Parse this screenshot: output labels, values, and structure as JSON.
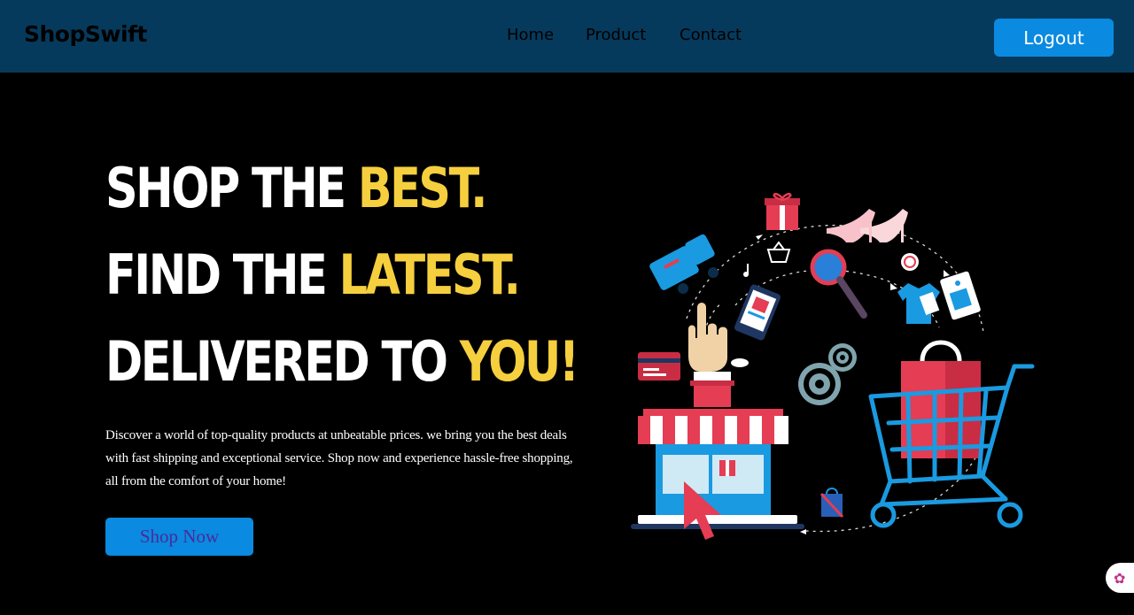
{
  "nav": {
    "brand": "ShopSwift",
    "links": [
      "Home",
      "Product",
      "Contact"
    ],
    "logout_label": "Logout"
  },
  "hero": {
    "line1": {
      "text": "SHOP THE ",
      "accent": "BEST."
    },
    "line2": {
      "text": "FIND THE ",
      "accent": "LATEST."
    },
    "line3": {
      "text": "DELIVERED TO ",
      "accent": "YOU!"
    },
    "description": "Discover a world of top-quality products at unbeatable prices. we bring you the best deals with fast shipping and exceptional service. Shop now and experience hassle-free shopping, all from the comfort of your home!",
    "cta_label": "Shop Now"
  },
  "colors": {
    "navbar": "#063a5c",
    "accent_yellow": "#f6cf3e",
    "button_blue": "#0a8ae0",
    "cta_text": "#4b2a9a"
  },
  "icons": {
    "illustration": "shopping-cart-illustration",
    "helper": "brain-icon"
  }
}
